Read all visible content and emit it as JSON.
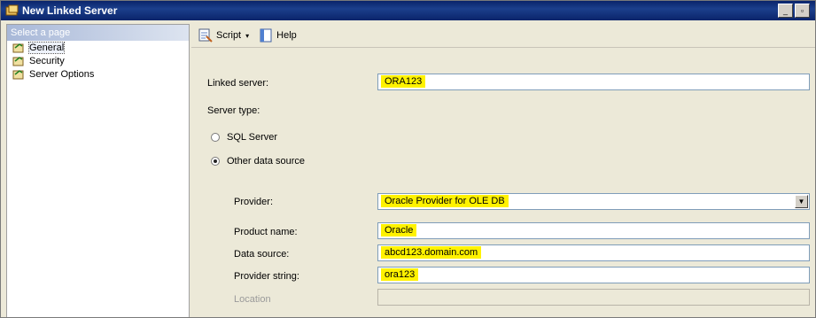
{
  "window": {
    "title": "New Linked Server",
    "minimize_symbol": "_",
    "restore_symbol": "▫"
  },
  "sidebar": {
    "header": "Select a page",
    "items": [
      {
        "label": "General",
        "selected": true
      },
      {
        "label": "Security",
        "selected": false
      },
      {
        "label": "Server Options",
        "selected": false
      }
    ]
  },
  "toolbar": {
    "script_label": "Script",
    "help_label": "Help",
    "caret": "▾"
  },
  "form": {
    "linked_server_label": "Linked server:",
    "linked_server_value": "ORA123",
    "server_type_label": "Server type:",
    "radio_sql_server_label": "SQL Server",
    "radio_other_label": "Other data source",
    "selected_server_type": "Other data source",
    "provider_label": "Provider:",
    "provider_value": "Oracle Provider for OLE DB",
    "dropdown_arrow": "▼",
    "product_name_label": "Product name:",
    "product_name_value": "Oracle",
    "data_source_label": "Data source:",
    "data_source_value": "abcd123.domain.com",
    "provider_string_label": "Provider string:",
    "provider_string_value": "ora123",
    "location_label": "Location"
  },
  "colors": {
    "highlight": "#fff200",
    "titlebar": "#0a246a"
  }
}
